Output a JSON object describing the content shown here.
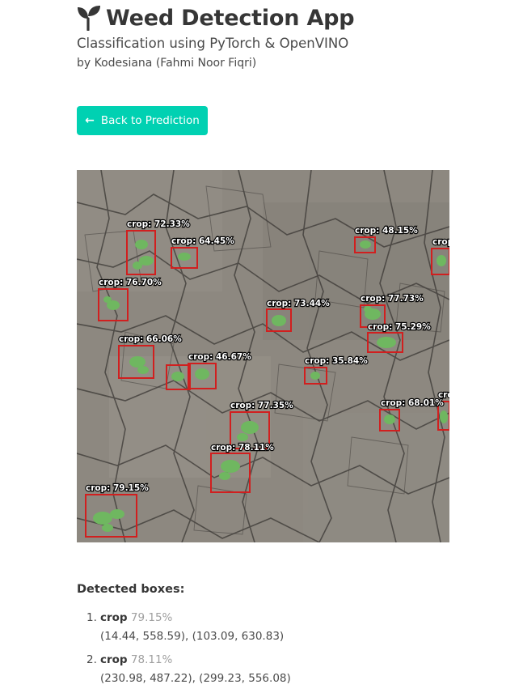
{
  "app": {
    "title": "Weed Detection App",
    "subtitle": "Classification using PyTorch & OpenVINO",
    "byline": "by Kodesiana (Fahmi Noor Fiqri)",
    "logo_icon": "seedling-icon"
  },
  "back_button": {
    "label": "Back to Prediction",
    "icon": "arrow-left-icon",
    "color": "#00d1b2"
  },
  "image": {
    "box_color": "#d11f1f",
    "labels": [
      "crop: 72.33%",
      "crop: 64.45%",
      "crop: 48.15%",
      "crop",
      "crop: 76.70%",
      "crop: 73.44%",
      "crop: 77.73%",
      "crop: 75.29%",
      "crop: 66.06%",
      "crop: 46.67%",
      "crop: 35.84%",
      "crop: 77.35%",
      "crop: 68.01%",
      "crop",
      "crop: 78.11%",
      "crop: 79.15%"
    ]
  },
  "detected_boxes": {
    "heading": "Detected boxes:",
    "items": [
      {
        "number": "1.",
        "label": "crop",
        "confidence": "79.15%",
        "coords": "(14.44, 558.59), (103.09, 630.83)"
      },
      {
        "number": "2.",
        "label": "crop",
        "confidence": "78.11%",
        "coords": "(230.98, 487.22), (299.23, 556.08)"
      }
    ]
  }
}
